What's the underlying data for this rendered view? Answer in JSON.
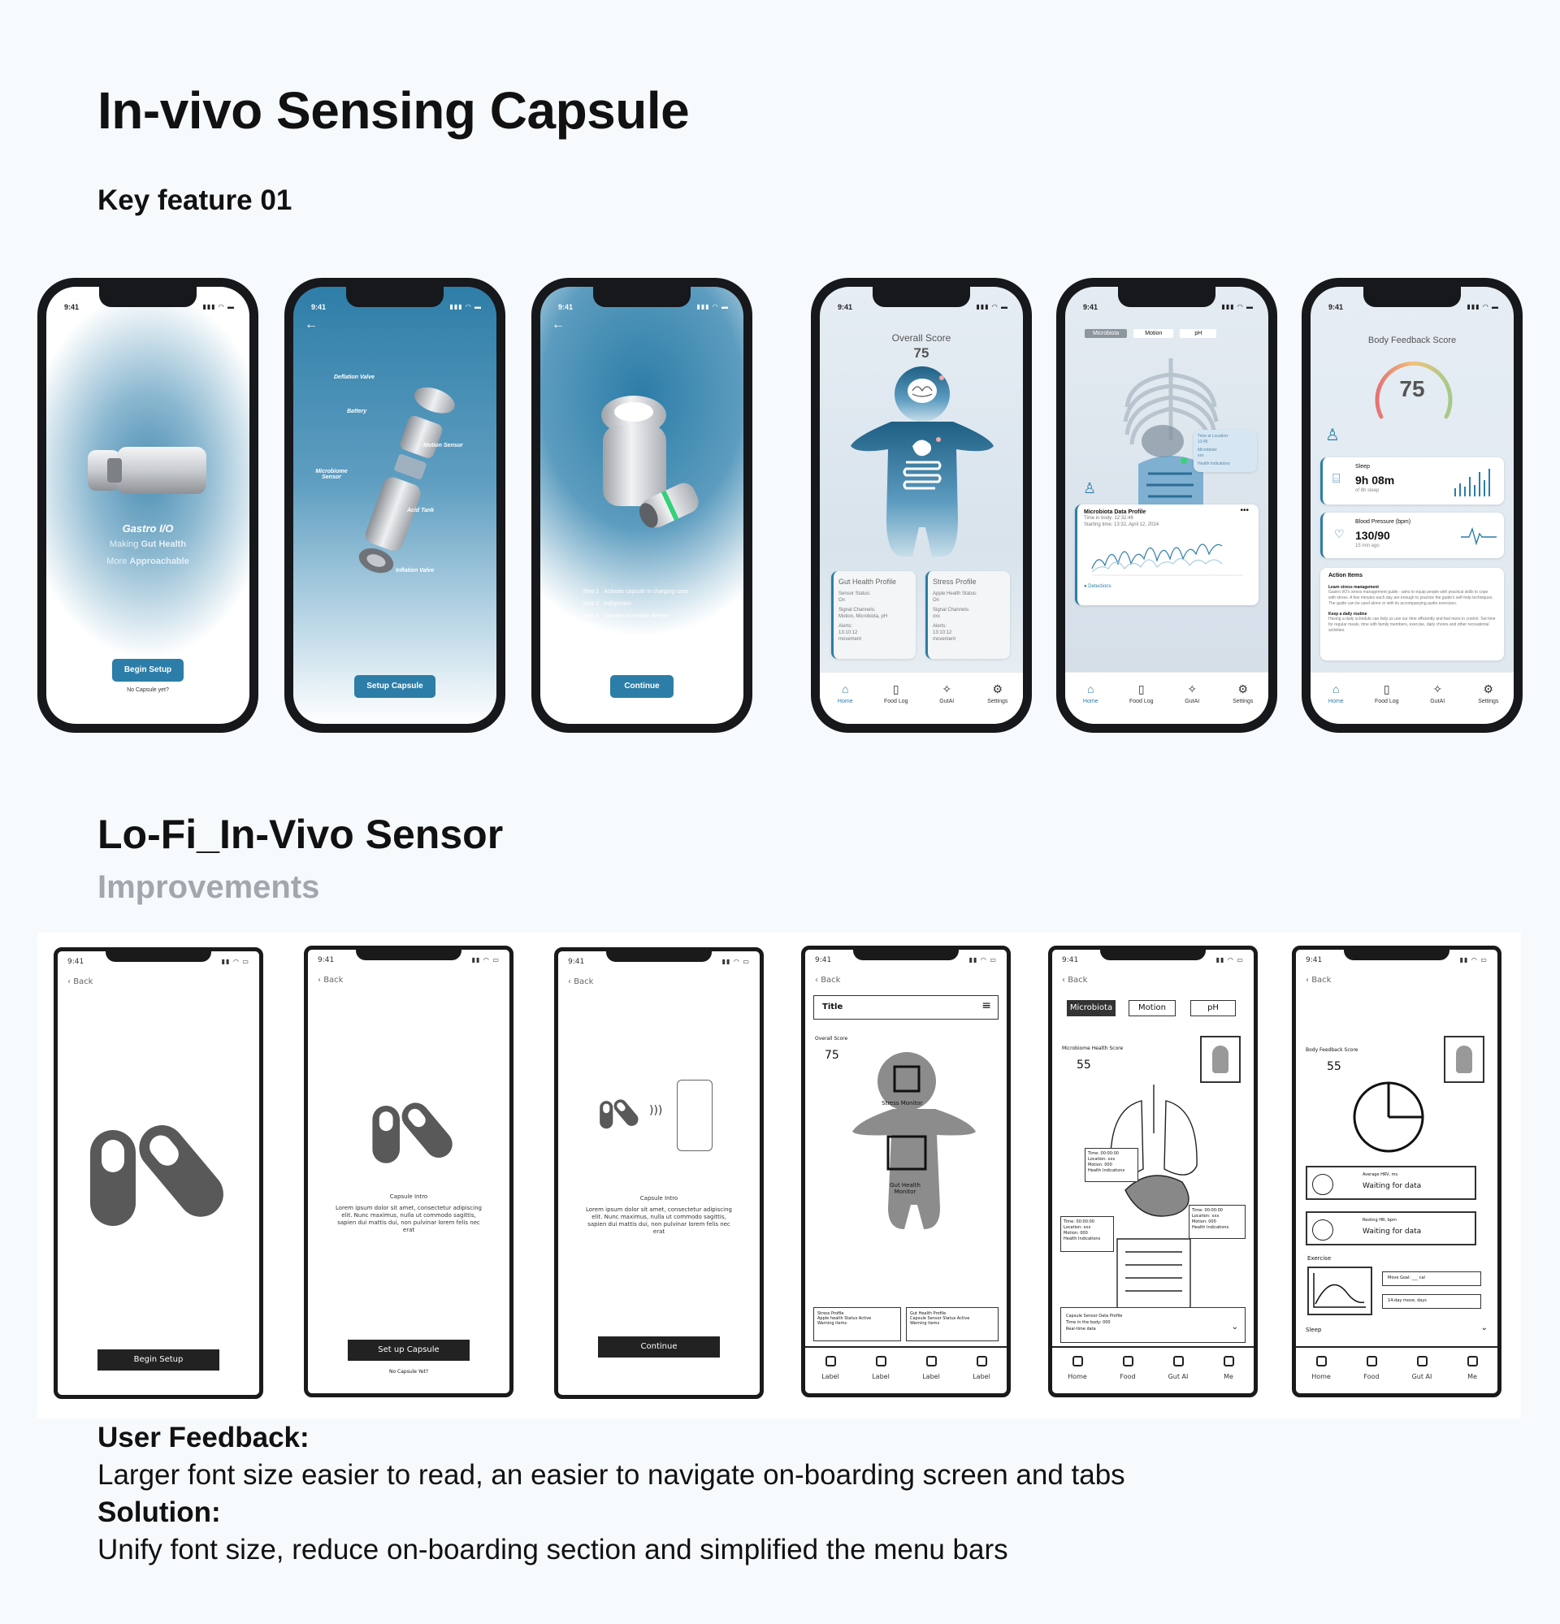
{
  "title": "In-vivo Sensing Capsule",
  "subtitle": "Key feature 01",
  "status_time": "9:41",
  "hifi": {
    "s1": {
      "brand": "Gastro I/O",
      "tag1a": "Making ",
      "tag1b": "Gut Health",
      "tag2a": "More ",
      "tag2b": "Approachable",
      "button": "Begin Setup",
      "link": "No Capsule yet?"
    },
    "s2": {
      "labels": {
        "deflation": "Deflation Valve",
        "battery": "Battery",
        "motion": "Motion Sensor",
        "microbiome": "Microbiome Sensor",
        "acid": "Acid Tank",
        "inflation": "Inflation Valve"
      },
      "button": "Setup Capsule"
    },
    "s3": {
      "steps": [
        {
          "n": "Step 1",
          "t": "Activate capsule in charging case"
        },
        {
          "n": "Step 2",
          "t": "Indigestion"
        },
        {
          "n": "Step 3",
          "t": "Connect to mobile device"
        }
      ],
      "button": "Continue"
    },
    "s4": {
      "score_label": "Overall Score",
      "score": "75",
      "card1": {
        "title": "Gut Health Profile",
        "l1": "Sensor Status:",
        "v1": "On",
        "l2": "Signal Channels:",
        "v2": "Motion, Microbiota, pH",
        "l3": "Alerts:",
        "v3": "13:10:12",
        "v4": "movement"
      },
      "card2": {
        "title": "Stress Profile",
        "l1": "Apple Health Status:",
        "v1": "On",
        "l2": "Signal Channels:",
        "v2": "xxx",
        "l3": "Alerts:",
        "v3": "13:10:12",
        "v4": "movement"
      }
    },
    "s5": {
      "tabs": [
        "Microbiota",
        "Motion",
        "pH"
      ],
      "callout": [
        "Time at Location:",
        "13:45",
        "Microbiota:",
        "xxx",
        "Health Indications"
      ],
      "card_title": "Microbiota Data Profile",
      "card_l1": "Time in body: 12:32:46",
      "card_l2": "Starting time: 13:32, April 12, 2024",
      "detections": "Detections"
    },
    "s6": {
      "score_label": "Body Feedback Score",
      "score": "75",
      "sleep": {
        "label": "Sleep",
        "value": "9h 08m",
        "sub": "of 8h sleep"
      },
      "bp": {
        "label": "Blood Pressure (bpm)",
        "value": "130/90",
        "sub": "15 min ago"
      },
      "actions": {
        "title": "Action Items",
        "a1t": "Learn stress management",
        "a1": "Gastro I/O's stress management guide - aims to equip people with practical skills to cope with stress. A few minutes each day are enough to practice the guide's self-help techniques. The guide can be used alone or with its accompanying audio exercises.",
        "a2t": "Keep a daily routine",
        "a2": "Having a daily schedule can help us use our time efficiently and feel more in control. Set time for regular meals, time with family members, exercise, daily chores and other recreational activities."
      }
    },
    "tabs": [
      "Home",
      "Food Log",
      "GutAI",
      "Settings"
    ]
  },
  "lofi_title": "Lo-Fi_In-Vivo Sensor",
  "lofi_sub": "Improvements",
  "lofi": {
    "back": "Back",
    "w1": {
      "button": "Begin Setup"
    },
    "w2": {
      "title": "Capsule Intro",
      "body": "Lorem ipsum dolor sit amet, consectetur adipiscing elit. Nunc maximus, nulla ut commodo sagittis, sapien dui mattis dui, non pulvinar lorem felis nec erat",
      "button": "Set up Capsule",
      "link": "No Capsule Yet?"
    },
    "w3": {
      "title": "Capsule Intro",
      "body": "Lorem ipsum dolor sit amet, consectetur adipiscing elit. Nunc maximus, nulla ut commodo sagittis, sapien dui mattis dui, non pulvinar lorem felis nec erat",
      "button": "Continue"
    },
    "w4": {
      "bar": "Title",
      "score_label": "Overall Score",
      "score": "75",
      "stress": "Stress Monitor",
      "gut": "Gut Health Monitor",
      "c1": [
        "Stress Profile",
        "Apple health Status Active",
        "Warning items"
      ],
      "c2": [
        "Gut Health Profile",
        "Capsule Sensor Status Active",
        "Warning items"
      ],
      "tabs": [
        "Label",
        "Label",
        "Label",
        "Label"
      ]
    },
    "w5": {
      "tabs3": [
        "Microbiota",
        "Motion",
        "pH"
      ],
      "score_label": "Microbiome Health Score",
      "score": "55",
      "co1": [
        "Time: 00:00:00",
        "Location: xxx",
        "Motion: 000",
        "Health Indications"
      ],
      "co2": [
        "Time: 00:00:00",
        "Location: xxx",
        "Motion: 000",
        "Health Indications"
      ],
      "co3": [
        "Time: 00:00:00",
        "Location: xxx",
        "Motion: 000",
        "Health Indications"
      ],
      "card": [
        "Capsule Sensor Data Profile",
        "Time in the body: 000",
        "Real-time data"
      ],
      "tabs": [
        "Home",
        "Food",
        "Gut AI",
        "Me"
      ]
    },
    "w6": {
      "score_label": "Body Feedback Score",
      "score": "55",
      "r1": [
        "Average HRV, ms",
        "Waiting for data"
      ],
      "r2": [
        "Resting HR, bpm",
        "Waiting for data"
      ],
      "exercise": "Exercise",
      "m1": "Move Goal: ___ cal",
      "m2": "14-day move, days",
      "sleep": "Sleep",
      "tabs": [
        "Home",
        "Food",
        "Gut AI",
        "Me"
      ]
    }
  },
  "feedback": {
    "h1": "User Feedback:",
    "t1": "Larger font size easier to read, an easier to navigate on-boarding screen and tabs",
    "h2": "Solution:",
    "t2": "Unify font size, reduce on-boarding section and simplified the menu bars"
  },
  "colors": {
    "accent": "#2c7da7",
    "bg": "#f6fafd",
    "wire": "#1a1a1a"
  }
}
